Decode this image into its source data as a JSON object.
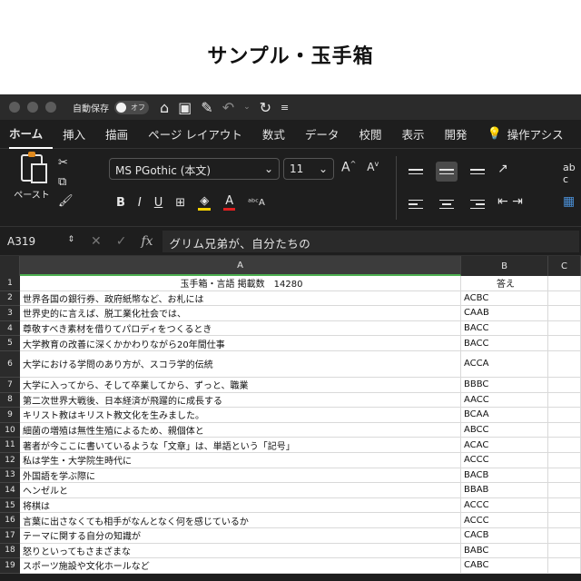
{
  "page_title": "サンプル・玉手箱",
  "titlebar": {
    "autosave_label": "自動保存",
    "toggle_label": "オフ"
  },
  "tabs": [
    "ホーム",
    "挿入",
    "描画",
    "ページ レイアウト",
    "数式",
    "データ",
    "校閲",
    "表示",
    "開発",
    "操作アシス"
  ],
  "ribbon": {
    "paste_label": "ペースト",
    "font_name": "MS PGothic (本文)",
    "font_size": "11",
    "bold": "B",
    "italic": "I",
    "underline": "U",
    "fill_letter": "A",
    "font_color_letter": "A",
    "extra_top": "ab c"
  },
  "formula_bar": {
    "cell_ref": "A319",
    "fx": "fx",
    "formula": "グリム兄弟が、自分たちの"
  },
  "columns": [
    "A",
    "B",
    "C"
  ],
  "rows": [
    {
      "n": "1",
      "a": "玉手箱・言語 掲載数　14280",
      "b": "答え"
    },
    {
      "n": "2",
      "a": "世界各国の銀行券、政府紙幣など、お札には",
      "b": "ACBC"
    },
    {
      "n": "3",
      "a": "世界史的に言えば、脱工業化社会では、",
      "b": "CAAB"
    },
    {
      "n": "4",
      "a": "尊敬すべき素材を借りてパロディをつくるとき",
      "b": "BACC"
    },
    {
      "n": "5",
      "a": "大学教育の改善に深くかかわりながら20年間仕事",
      "b": "BACC"
    },
    {
      "n": "6",
      "a": "大学における学問のあり方が、スコラ学的伝統",
      "b": "ACCA"
    },
    {
      "n": "7",
      "a": "大学に入ってから、そして卒業してから、ずっと、職業",
      "b": "BBBC"
    },
    {
      "n": "8",
      "a": "第二次世界大戦後、日本経済が飛躍的に成長する",
      "b": "AACC"
    },
    {
      "n": "9",
      "a": "キリスト教はキリスト教文化を生みました。",
      "b": "BCAA"
    },
    {
      "n": "10",
      "a": "細菌の増殖は無性生殖によるため、親個体と",
      "b": "ABCC"
    },
    {
      "n": "11",
      "a": "著者が今ここに書いているような「文章」は、単語という「記号」",
      "b": "ACAC"
    },
    {
      "n": "12",
      "a": "私は学生・大学院生時代に",
      "b": "ACCC"
    },
    {
      "n": "13",
      "a": "外国語を学ぶ際に",
      "b": "BACB"
    },
    {
      "n": "14",
      "a": "ヘンゼルと",
      "b": "BBAB"
    },
    {
      "n": "15",
      "a": "将棋は",
      "b": "ACCC"
    },
    {
      "n": "16",
      "a": "言葉に出さなくても相手がなんとなく何を感じているか",
      "b": "ACCC"
    },
    {
      "n": "17",
      "a": "テーマに関する自分の知識が",
      "b": "CACB"
    },
    {
      "n": "18",
      "a": "怒りといってもさまざまな",
      "b": "BABC"
    },
    {
      "n": "19",
      "a": "スポーツ施設や文化ホールなど",
      "b": "CABC"
    }
  ]
}
